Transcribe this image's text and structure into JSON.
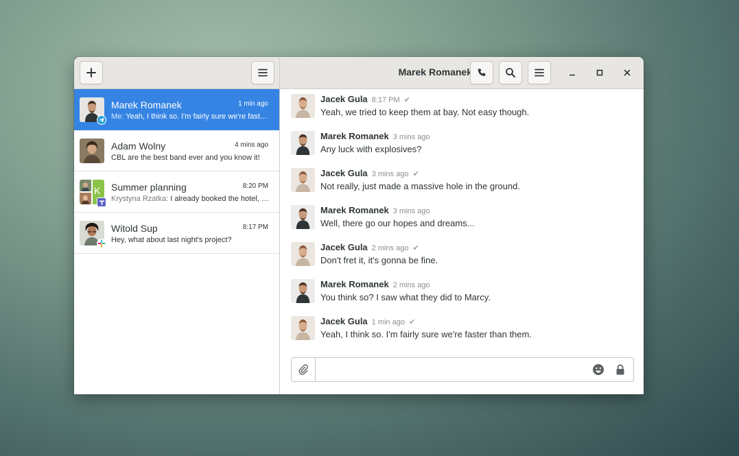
{
  "header": {
    "chat_title": "Marek Romanek"
  },
  "icons": {
    "new": "plus-icon",
    "menu": "hamburger-menu-icon",
    "call": "phone-icon",
    "search": "search-icon",
    "minimize": "minimize-icon",
    "maximize": "maximize-icon",
    "close": "close-icon"
  },
  "conversations": [
    {
      "name": "Marek Romanek",
      "time": "1 min ago",
      "sender": "Me:",
      "preview": "Yeah, I think so. I'm fairly sure we're faster than them.",
      "protocol": "telegram",
      "active": true
    },
    {
      "name": "Adam Wolny",
      "time": "4 mins ago",
      "sender": "",
      "preview": "CBL are the best band ever and you know it!",
      "protocol": "",
      "active": false
    },
    {
      "name": "Summer planning",
      "time": "8:20 PM",
      "sender": "Krystyna Rzatka:",
      "preview": "I already booked the hotel, we'll be there by noon.",
      "protocol": "teams",
      "avatar_letter": "K",
      "active": false
    },
    {
      "name": "Witold Sup",
      "time": "8:17 PM",
      "sender": "",
      "preview": "Hey, what about last night's project?",
      "protocol": "slack",
      "active": false
    }
  ],
  "messages": [
    {
      "author": "Jacek Gula",
      "time": "8:17 PM",
      "read": "✔",
      "text": "Yeah, we tried to keep them at bay. Not easy though."
    },
    {
      "author": "Marek Romanek",
      "time": "3 mins ago",
      "read": "",
      "text": "Any luck with explosives?"
    },
    {
      "author": "Jacek Gula",
      "time": "3 mins ago",
      "read": "✔",
      "text": "Not really, just made a massive hole in the ground."
    },
    {
      "author": "Marek Romanek",
      "time": "3 mins ago",
      "read": "",
      "text": "Well, there go our hopes and dreams..."
    },
    {
      "author": "Jacek Gula",
      "time": "2 mins ago",
      "read": "✔",
      "text": "Don't fret it, it's gonna be fine."
    },
    {
      "author": "Marek Romanek",
      "time": "2 mins ago",
      "read": "",
      "text": "You think so? I saw what they did to Marcy."
    },
    {
      "author": "Jacek Gula",
      "time": "1 min ago",
      "read": "✔",
      "text": "Yeah, I think so. I'm fairly sure we're faster than them."
    }
  ],
  "composer": {
    "placeholder": ""
  },
  "colors": {
    "accent": "#3584e4",
    "headerbar": "#e8e6e3"
  }
}
